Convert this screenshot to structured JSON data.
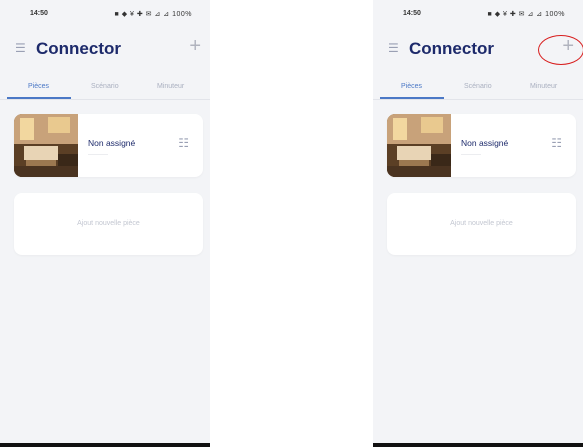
{
  "screens": [
    {
      "status": {
        "time": "14:50",
        "icons": "■ ◆ ¥ ✚ ✉ ⊿ ⊿ 100%"
      },
      "header": {
        "title": "Connector"
      },
      "tabs": [
        {
          "label": "Pièces",
          "active": true
        },
        {
          "label": "Scénario",
          "active": false
        },
        {
          "label": "Minuteur",
          "active": false
        }
      ],
      "room": {
        "name": "Non assigné",
        "sub": "—————"
      },
      "add_room": {
        "label": "Ajout nouvelle pièce"
      }
    },
    {
      "status": {
        "time": "14:50",
        "icons": "■ ◆ ¥ ✚ ✉ ⊿ ⊿ 100%"
      },
      "header": {
        "title": "Connector"
      },
      "tabs": [
        {
          "label": "Pièces",
          "active": true
        },
        {
          "label": "Scénario",
          "active": false
        },
        {
          "label": "Minuteur",
          "active": false
        }
      ],
      "room": {
        "name": "Non assigné",
        "sub": "—————"
      },
      "add_room": {
        "label": "Ajout nouvelle pièce"
      }
    }
  ],
  "icons": {
    "menu": "menu-icon",
    "add": "plus-icon",
    "settings": "settings-sliders-icon"
  },
  "colors": {
    "title": "#1d2a6b",
    "accent": "#4b78c6",
    "background": "#f3f4f7",
    "annotation": "#d81e1e"
  }
}
